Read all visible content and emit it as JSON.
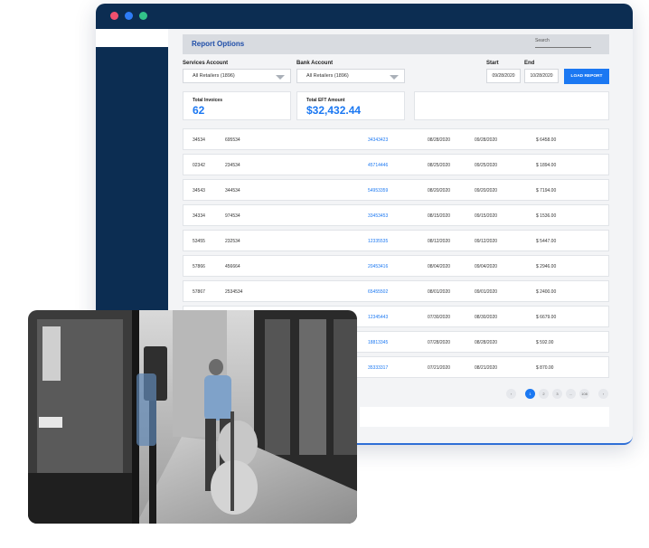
{
  "report": {
    "title": "Report Options",
    "search_label": "Search",
    "services_label": "Services Account",
    "services_value": "All Retailers (1896)",
    "bank_label": "Bank Account",
    "bank_value": "All Retailers (1896)",
    "start_label": "Start",
    "start_value": "09/28/2020",
    "end_label": "End",
    "end_value": "10/28/2020",
    "load_button": "LOAD REPORT",
    "total_invoices_label": "Total Invoices",
    "total_invoices_value": "62",
    "total_eft_label": "Total EFT Amount",
    "total_eft_value": "$32,432.44"
  },
  "rows": [
    {
      "c1": "34534",
      "c2": "695534",
      "inv": "34343423",
      "d1": "08/28/2020",
      "d2": "09/28/2020",
      "amt": "$ 6458.00"
    },
    {
      "c1": "02342",
      "c2": "234534",
      "inv": "45714446",
      "d1": "08/25/2020",
      "d2": "09/25/2020",
      "amt": "$ 1894.00"
    },
    {
      "c1": "34543",
      "c2": "344534",
      "inv": "54953359",
      "d1": "08/20/2020",
      "d2": "09/20/2020",
      "amt": "$ 7194.00"
    },
    {
      "c1": "34334",
      "c2": "974534",
      "inv": "33453453",
      "d1": "08/15/2020",
      "d2": "09/15/2020",
      "amt": "$ 1536.00"
    },
    {
      "c1": "53455",
      "c2": "232534",
      "inv": "12335535",
      "d1": "08/12/2020",
      "d2": "09/12/2020",
      "amt": "$ 5447.00"
    },
    {
      "c1": "57866",
      "c2": "456664",
      "inv": "20453416",
      "d1": "08/04/2020",
      "d2": "09/04/2020",
      "amt": "$ 2946.00"
    },
    {
      "c1": "57867",
      "c2": "2534534",
      "inv": "65455502",
      "d1": "08/01/2020",
      "d2": "09/01/2020",
      "amt": "$ 2400.00"
    },
    {
      "c1": "",
      "c2": "",
      "inv": "12345443",
      "d1": "07/30/2020",
      "d2": "08/30/2020",
      "amt": "$ 6679.00"
    },
    {
      "c1": "",
      "c2": "",
      "inv": "18813345",
      "d1": "07/28/2020",
      "d2": "08/28/2020",
      "amt": "$ 592.00"
    },
    {
      "c1": "",
      "c2": "",
      "inv": "35333317",
      "d1": "07/21/2020",
      "d2": "08/21/2020",
      "amt": "$ 870.00"
    }
  ],
  "pagination": [
    "1",
    "2",
    "3",
    "...",
    "108"
  ],
  "colors": {
    "navy": "#0c2d52",
    "accent": "#1b78f2"
  },
  "icons": {
    "prev": "chevron-left-icon",
    "next": "chevron-right-icon",
    "dropdown": "caret-down-icon"
  }
}
